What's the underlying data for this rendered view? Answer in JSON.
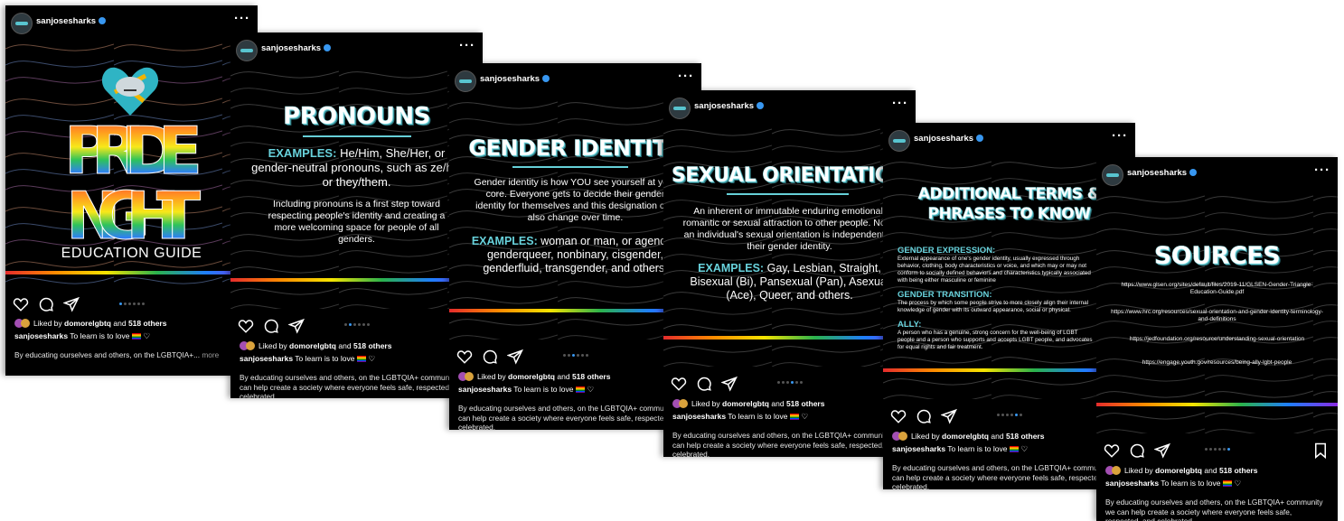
{
  "username": "sanjosesharks",
  "liked_by_user": "domorelgbtq",
  "liked_others": "518 others",
  "liked_prefix": "Liked by",
  "liked_and": "and",
  "caption_text": "To learn is to love",
  "description": "By educating ourselves and others, on the LGBTQIA+ community we can help create a society where everyone feels safe, respected, and celebrated.",
  "description_short": "By educating ourselves and others, on the LGBTQIA+...",
  "more_label": "more",
  "more_icon": "···",
  "colors": {
    "teal": "#68d2dc",
    "verified": "#3897f0",
    "active_dot": "#3897f0"
  },
  "slides": [
    {
      "title_line1": "PRIDE",
      "title_line2": "NIGHT",
      "subtitle": "EDUCATION GUIDE",
      "active_dot": 1
    },
    {
      "title": "PRONOUNS",
      "examples_label": "EXAMPLES:",
      "examples_text": "He/Him, She/Her, or gender-neutral pronouns, such as ze/hir, or they/them.",
      "body": "Including pronouns is a first step toward respecting people's identity and creating a more welcoming space for people of all genders.",
      "active_dot": 2
    },
    {
      "title": "GENDER IDENTITY",
      "body": "Gender identity is how YOU see yourself at your core. Everyone gets to decide their gender identity for themselves and this designation can also change over time.",
      "examples_label": "EXAMPLES:",
      "examples_text": "woman or man, or agender, genderqueer, nonbinary, cisgender, genderfluid, transgender, and others.",
      "active_dot": 3
    },
    {
      "title": "SEXUAL ORIENTATION",
      "body": "An inherent or immutable enduring emotional, romantic or sexual attraction to other people. Note: an individual's sexual orientation is independent of their gender identity.",
      "examples_label": "EXAMPLES:",
      "examples_text": "Gay, Lesbian, Straight, Bisexual (Bi), Pansexual (Pan), Asexual (Ace), Queer, and others.",
      "active_dot": 4
    },
    {
      "title_line1": "ADDITIONAL TERMS &",
      "title_line2": "PHRASES TO KNOW",
      "terms": [
        {
          "term": "GENDER EXPRESSION:",
          "def": "External appearance of one's gender identity, usually expressed through behavior, clothing, body characteristics or voice, and which may or may not conform to socially defined behaviors and characteristics typically associated with being either masculine or feminine"
        },
        {
          "term": "GENDER TRANSITION:",
          "def": "The process by which some people strive to more closely align their internal knowledge of gender with its outward appearance, social or physical."
        },
        {
          "term": "ALLY:",
          "def": "A person who has a genuine, strong concern for the well-being of LGBT people and a person who supports and accepts LGBT people, and advocates for equal rights and fair treatment."
        }
      ],
      "active_dot": 5
    },
    {
      "title": "SOURCES",
      "links": [
        "https://www.glsen.org/sites/default/files/2019-11/GLSEN-Gender-Triangle-Education-Guide.pdf",
        "https://www.hrc.org/resources/sexual-orientation-and-gender-identity-terminology-and-definitions",
        "https://jedfoundation.org/resource/understanding-sexual-orientation",
        "https://engage.youth.gov/resources/being-ally-lgbt-people"
      ],
      "active_dot": 6
    }
  ]
}
